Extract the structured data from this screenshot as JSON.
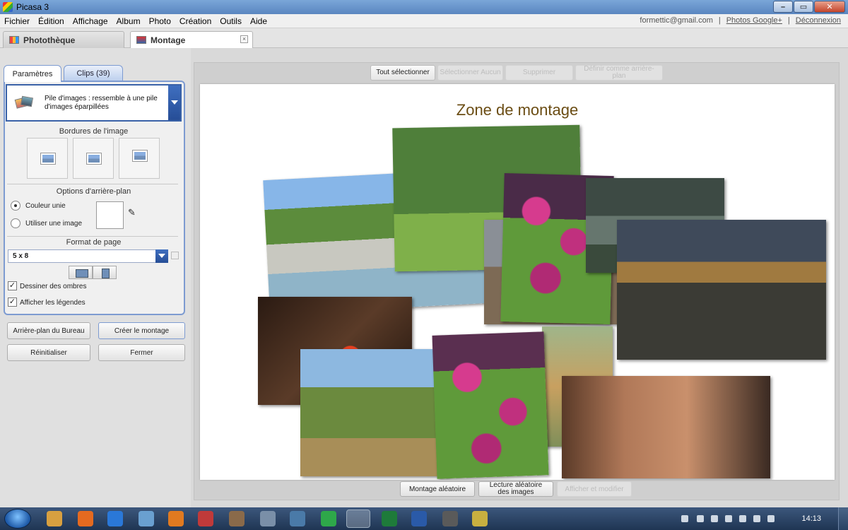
{
  "window": {
    "title": "Picasa 3"
  },
  "menu": {
    "items": [
      "Fichier",
      "Édition",
      "Affichage",
      "Album",
      "Photo",
      "Création",
      "Outils",
      "Aide"
    ],
    "account_email": "formettic@gmail.com",
    "sep": "|",
    "photos_link": "Photos Google+",
    "logout_link": "Déconnexion"
  },
  "tabs": {
    "library": "Photothèque",
    "montage": "Montage",
    "close_glyph": "×"
  },
  "panel": {
    "tab_params": "Paramètres",
    "tab_clips": "Clips (39)",
    "layout_text": "Pile d'images : ressemble à une pile d'images éparpillées",
    "borders_title": "Bordures de l'image",
    "background_title": "Options d'arrière-plan",
    "solid_color": "Couleur unie",
    "use_image": "Utiliser une image",
    "page_format_title": "Format de page",
    "page_format_value": "5 x 8",
    "draw_shadows": "Dessiner des ombres",
    "show_captions": "Afficher les légendes",
    "background_color": "#ffffff"
  },
  "actions": {
    "desktop_bg": "Arrière-plan du Bureau",
    "create_montage": "Créer le montage",
    "reset": "Réinitialiser",
    "close": "Fermer"
  },
  "toolbar": {
    "select_all": "Tout sélectionner",
    "select_none": "Sélectionner Aucun",
    "delete": "Supprimer",
    "set_background": "Définir comme arrière-plan"
  },
  "canvas": {
    "title": "Zone de montage"
  },
  "bottom": {
    "random_montage": "Montage aléatoire",
    "shuffle_images": "Lecture aléatoire des images",
    "view_edit": "Afficher et modifier"
  },
  "taskbar": {
    "clock": "14:13"
  },
  "colors": {
    "accent": "#7d9bd1",
    "title_text": "#6b4d14"
  }
}
